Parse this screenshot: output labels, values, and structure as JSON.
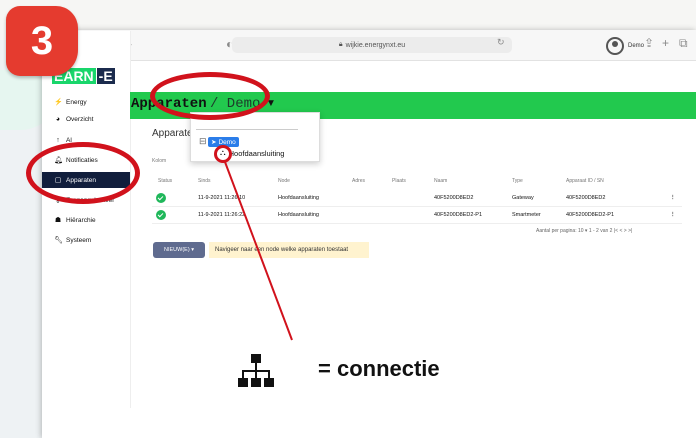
{
  "badge": {
    "number": "3"
  },
  "browser": {
    "url": "wijkie.energynxt.eu"
  },
  "logo": {
    "part1": "EARN",
    "part2": "-E"
  },
  "sidebar": {
    "items": [
      {
        "label": "Energy",
        "icon": "energy-icon"
      },
      {
        "label": "Overzicht",
        "icon": "dashboard-icon"
      },
      {
        "label": "Al",
        "icon": "chart-icon"
      },
      {
        "label": "Notificaties",
        "icon": "bell-icon"
      },
      {
        "label": "Apparaten",
        "icon": "device-icon",
        "active": true
      },
      {
        "label": "Toegangsbeheer",
        "icon": "key-icon"
      },
      {
        "label": "Hiërarchie",
        "icon": "hierarchy-icon"
      },
      {
        "label": "Systeem",
        "icon": "wrench-icon"
      }
    ]
  },
  "topbar": {
    "user": "Demo"
  },
  "header": {
    "title": "Apparaten",
    "subtitle": "/ Demo"
  },
  "card": {
    "title": "Apparaten",
    "filter_label": "Kolom"
  },
  "dropdown": {
    "node": "Demo",
    "child": "Hoofdaansluiting"
  },
  "table": {
    "columns": [
      "Status",
      "Sinds",
      "Node",
      "Adres",
      "Plaats",
      "Naam",
      "Type",
      "Apparaat ID / SN"
    ],
    "rows": [
      {
        "since": "11-9-2021 11:26:10",
        "node": "Hoofdaansluiting",
        "name": "40F5200D8ED2",
        "type": "Gateway",
        "device_id": "40F5200D8ED2"
      },
      {
        "since": "11-9-2021 11:26:22",
        "node": "Hoofdaansluiting",
        "name": "40F5200D8ED2-P1",
        "type": "Smartmeter",
        "device_id": "40F5200D8ED2-P1"
      }
    ],
    "pagination": "Aantal per pagina: 10 ▾   1 - 2 van 2   |<   <   >   >|"
  },
  "actions": {
    "new_button": "NIEUW(E) ▾",
    "hint": "Navigeer naar een node welke apparaten toestaat"
  },
  "legend": {
    "text": "= connectie"
  },
  "colors": {
    "accent_green": "#22c94e",
    "annotation_red": "#d1121c",
    "sidebar_active": "#111e3c"
  }
}
